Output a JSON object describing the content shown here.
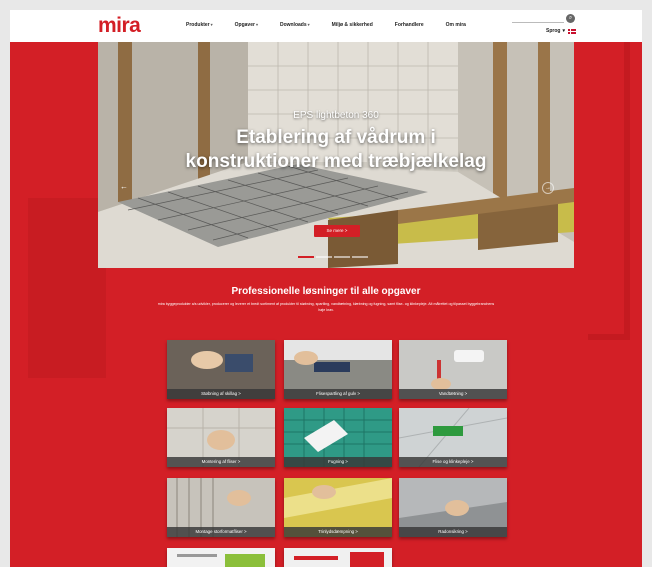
{
  "header": {
    "logo": "mira",
    "nav": [
      {
        "label": "Produkter",
        "caret": "▾"
      },
      {
        "label": "Opgaver",
        "caret": "▾"
      },
      {
        "label": "Downloads",
        "caret": "▾"
      },
      {
        "label": "Miljø & sikkerhed",
        "caret": ""
      },
      {
        "label": "Forhandlere",
        "caret": ""
      },
      {
        "label": "Om mira",
        "caret": ""
      }
    ],
    "language_label": "Sprog",
    "language_caret": "▾"
  },
  "hero": {
    "subtitle": "EPS lightbeton 360",
    "title_line1": "Etablering af vådrum i",
    "title_line2": "konstruktioner med træbjælkelag",
    "button_label": "Se mere >",
    "prev_arrow": "←",
    "next_arrow": "→"
  },
  "section": {
    "title": "Professionelle løsninger til alle opgaver",
    "description": "mira byggeprodukter a/s udvikler, producerer og leverer et bredt sortiment af produkter til støbning, spartling, vandtætning, klæbning og fugning, samt flise- og klinkepleje. Alt målrettet og tilpasset byggebranchens høje krav."
  },
  "tiles": [
    {
      "label": "Støbning af skillag >",
      "color": "#6b6259"
    },
    {
      "label": "Flisespartling af gulv >",
      "color": "#8a8a84"
    },
    {
      "label": "Vandtætning >",
      "color": "#c9c9c6"
    },
    {
      "label": "Montering af fliser >",
      "color": "#d6d3cc"
    },
    {
      "label": "Fugning >",
      "color": "#2f9a86"
    },
    {
      "label": "Flise og klinkepleje >",
      "color": "#cfd3d4"
    },
    {
      "label": "Montage storformatfliser >",
      "color": "#c7c3bb"
    },
    {
      "label": "Trinlydsdæmpning >",
      "color": "#d9c64f"
    },
    {
      "label": "Radonsikring >",
      "color": "#b6b8ba"
    },
    {
      "label": "",
      "color": "#f2f2f2"
    },
    {
      "label": "",
      "color": "#f0f0f0"
    }
  ]
}
